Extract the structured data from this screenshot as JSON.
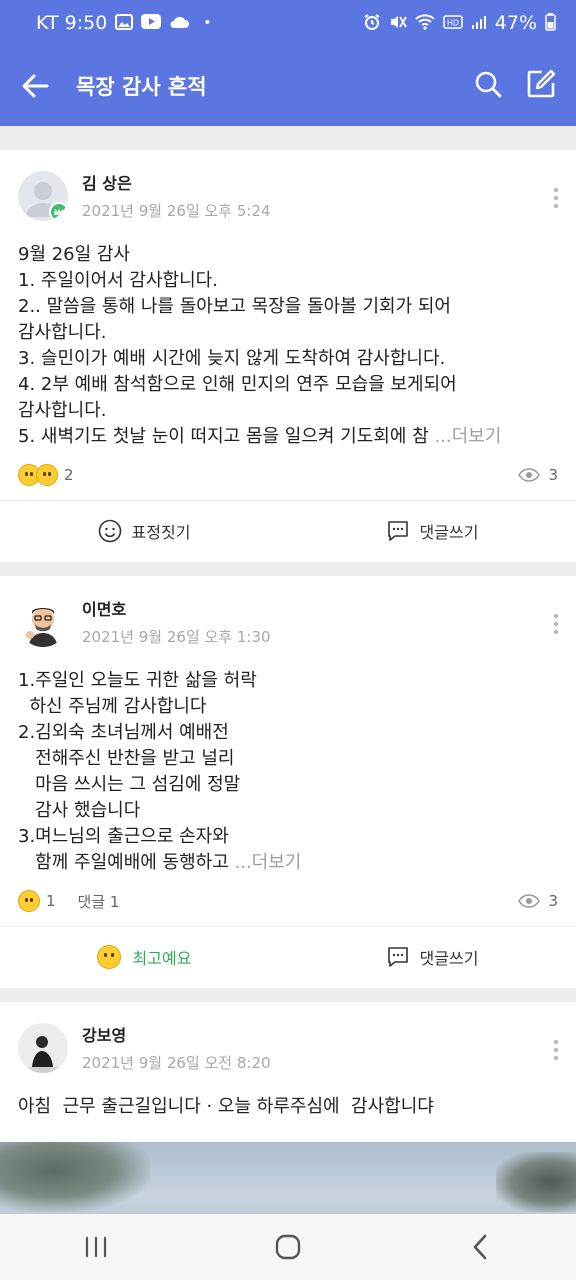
{
  "status_bar": {
    "carrier_time": "KT 9:50",
    "dot": "•",
    "battery": "47%"
  },
  "app_bar": {
    "title": "목장 감사 흔적"
  },
  "posts": [
    {
      "author": "김 상은",
      "date": "2021년 9월 26일 오후 5:24",
      "body": "9월 26일 감사\n1. 주일이어서 감사합니다.\n2.. 말씀을 통해 나를 돌아보고 목장을 돌아볼 기회가 되어\n감사합니다.\n3. 슬민이가 예배 시간에 늦지 않게 도착하여 감사합니다.\n4. 2부 예배 참석함으로 인해 민지의 연주 모습을 보게되어\n감사합니다.\n5. 새벽기도 첫날 눈이 떠지고 몸을 일으켜 기도회에 참 ",
      "more": "...더보기",
      "reaction_count": "2",
      "comment_text": "",
      "views": "3",
      "action_left": "표정짓기",
      "action_right": "댓글쓰기"
    },
    {
      "author": "이면호",
      "date": "2021년 9월 26일 오후 1:30",
      "body": "1.주일인 오늘도 귀한 삶을 허락\n  하신 주님께 감사합니다\n2.김외숙 초녀님께서 예배전\n   전해주신 반찬을 받고 널리\n   마음 쓰시는 그 섬김에 정말\n   감사 했습니다\n3.며느님의 출근으로 손자와\n   함께 주일예배에 동행하고 ",
      "more": "...더보기",
      "reaction_count": "1",
      "comment_text": "댓글 1",
      "views": "3",
      "action_left": "최고예요",
      "action_right": "댓글쓰기"
    },
    {
      "author": "강보영",
      "date": "2021년 9월 26일 오전 8:20",
      "body": "아침  근무 출근길입니다 · 오늘 하루주심에  감사합니댜"
    }
  ]
}
